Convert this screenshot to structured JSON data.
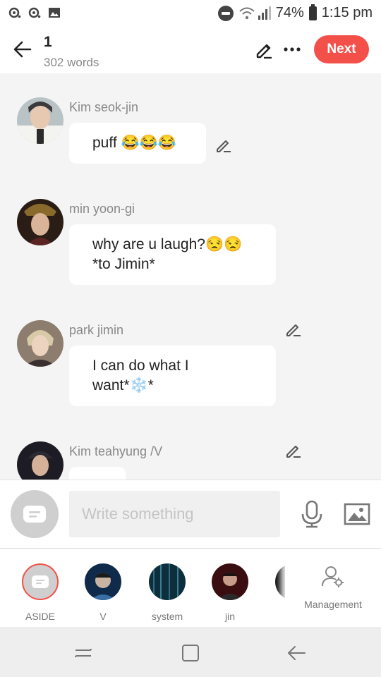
{
  "status_bar": {
    "battery": "74%",
    "time": "1:15 pm"
  },
  "header": {
    "title": "1",
    "word_count": "302 words",
    "next_label": "Next"
  },
  "messages": [
    {
      "speaker": "Kim seok-jin",
      "text": "puff 😂😂😂"
    },
    {
      "speaker": "min yoon-gi",
      "line1": "why are u laugh?😒😒",
      "line2": "*to Jimin*"
    },
    {
      "speaker": "park jimin",
      "line1": "I can do what I",
      "line2": "want*❄️*"
    },
    {
      "speaker": "Kim teahyung /V"
    }
  ],
  "composer": {
    "placeholder": "Write something"
  },
  "characters": [
    {
      "name": "ASIDE"
    },
    {
      "name": "V"
    },
    {
      "name": "system"
    },
    {
      "name": "jin"
    }
  ],
  "management_label": "Management",
  "colors": {
    "accent": "#f4504a",
    "background": "#f4f4f4"
  }
}
